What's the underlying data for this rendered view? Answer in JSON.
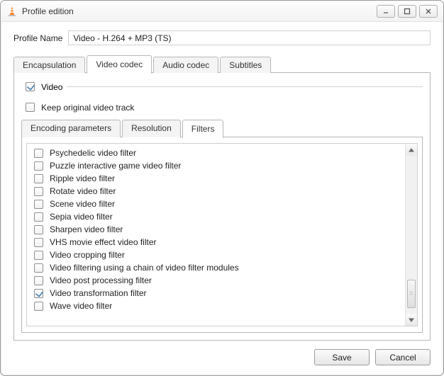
{
  "window": {
    "title": "Profile edition"
  },
  "profile": {
    "label": "Profile Name",
    "value": "Video - H.264 + MP3 (TS)"
  },
  "tabs": {
    "encapsulation": "Encapsulation",
    "video_codec": "Video codec",
    "audio_codec": "Audio codec",
    "subtitles": "Subtitles",
    "active": "video_codec"
  },
  "video_codec": {
    "video_checkbox": {
      "label": "Video",
      "checked": true
    },
    "keep_original": {
      "label": "Keep original video track",
      "checked": false
    },
    "subtabs": {
      "encoding": "Encoding parameters",
      "resolution": "Resolution",
      "filters": "Filters",
      "active": "filters"
    },
    "filters": [
      {
        "label": "Psychedelic video filter",
        "checked": false
      },
      {
        "label": "Puzzle interactive game video filter",
        "checked": false
      },
      {
        "label": "Ripple video filter",
        "checked": false
      },
      {
        "label": "Rotate video filter",
        "checked": false
      },
      {
        "label": "Scene video filter",
        "checked": false
      },
      {
        "label": "Sepia video filter",
        "checked": false
      },
      {
        "label": "Sharpen video filter",
        "checked": false
      },
      {
        "label": "VHS movie effect video filter",
        "checked": false
      },
      {
        "label": "Video cropping filter",
        "checked": false
      },
      {
        "label": "Video filtering using a chain of video filter modules",
        "checked": false
      },
      {
        "label": "Video post processing filter",
        "checked": false
      },
      {
        "label": "Video transformation filter",
        "checked": true
      },
      {
        "label": "Wave video filter",
        "checked": false
      }
    ]
  },
  "buttons": {
    "save": "Save",
    "cancel": "Cancel"
  }
}
